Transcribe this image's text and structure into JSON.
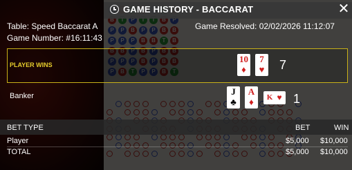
{
  "header": {
    "title": "GAME HISTORY - BACCARAT",
    "history_icon": "history-icon",
    "close_glyph": "✕"
  },
  "game": {
    "table": "Table: Speed Baccarat A",
    "number": "Game Number: #16:11:43",
    "resolved": "Game Resolved: 02/02/2026 11:12:07"
  },
  "player": {
    "label": "PLAYER WINS",
    "cards": [
      {
        "rank": "10",
        "suit": "♦",
        "color": "red"
      },
      {
        "rank": "7",
        "suit": "♥",
        "color": "red"
      }
    ],
    "score": "7"
  },
  "banker": {
    "label": "Banker",
    "cards": [
      {
        "rank": "J",
        "suit": "♣",
        "color": "black"
      },
      {
        "rank": "A",
        "suit": "♦",
        "color": "red"
      }
    ],
    "third_card": {
      "rank": "K",
      "suit": "♥",
      "color": "red"
    },
    "score": "1"
  },
  "bets": {
    "columns": [
      "BET TYPE",
      "BET",
      "WIN"
    ],
    "rows": [
      {
        "type": "Player",
        "bet": "$5,000",
        "win": "$10,000"
      }
    ],
    "total": {
      "type": "TOTAL",
      "bet": "$5,000",
      "win": "$10,000"
    }
  },
  "colors": {
    "accent_gold": "#c9b118",
    "player_blue": "#3b5ac7",
    "banker_red": "#c8302a",
    "tie_green": "#2e9d3a"
  },
  "bead_road": [
    [
      "p",
      "b",
      "t",
      "b",
      "p",
      "t",
      "b"
    ],
    [
      "b",
      "t",
      "p",
      "t",
      "t",
      "b",
      "p"
    ],
    [
      "p",
      "p",
      "b",
      "p",
      "p",
      "b",
      "b"
    ],
    [
      "p",
      "p",
      "p",
      "b",
      "b",
      "t",
      "b"
    ],
    [
      "b",
      "b",
      "p",
      "b",
      "p",
      "b",
      "b"
    ],
    [
      "p",
      "p",
      "p",
      "b",
      "p",
      "b",
      "b"
    ],
    [
      "p",
      "b",
      "t",
      "p",
      "p",
      "b",
      "t"
    ]
  ]
}
